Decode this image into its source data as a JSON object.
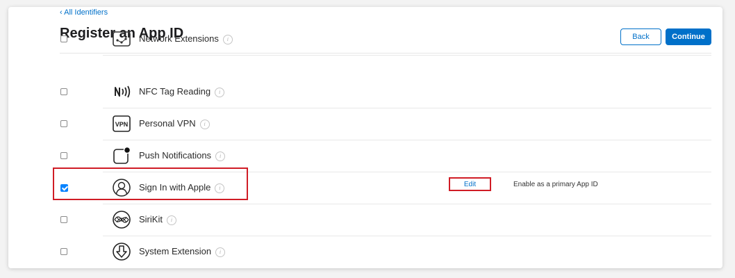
{
  "header": {
    "breadcrumb": "‹ All Identifiers",
    "title": "Register an App ID",
    "back_label": "Back",
    "continue_label": "Continue"
  },
  "colors": {
    "accent": "#0070c9",
    "highlight": "#d01c25",
    "checkbox_checked": "#0a84ff"
  },
  "capabilities": [
    {
      "label": "Network Extensions",
      "icon": "network-extensions-icon",
      "checked": false
    },
    {
      "label": "NFC Tag Reading",
      "icon": "nfc-icon",
      "checked": false
    },
    {
      "label": "Personal VPN",
      "icon": "vpn-icon",
      "checked": false
    },
    {
      "label": "Push Notifications",
      "icon": "push-notifications-icon",
      "checked": false
    },
    {
      "label": "Sign In with Apple",
      "icon": "sign-in-with-apple-icon",
      "checked": true,
      "edit_label": "Edit",
      "note": "Enable as a primary App ID"
    },
    {
      "label": "SiriKit",
      "icon": "sirikit-icon",
      "checked": false
    },
    {
      "label": "System Extension",
      "icon": "system-extension-icon",
      "checked": false
    }
  ],
  "info_glyph": "i"
}
